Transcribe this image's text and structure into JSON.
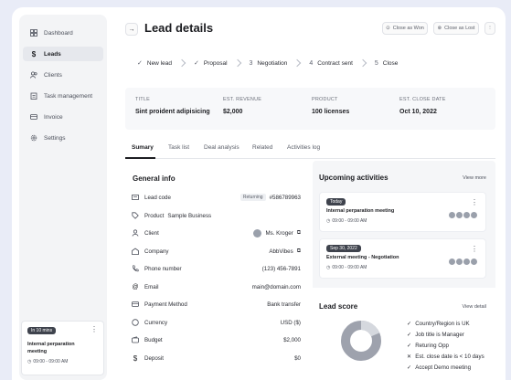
{
  "sidebar": {
    "items": [
      {
        "label": "Dashboard",
        "icon": "grid-icon"
      },
      {
        "label": "Leads",
        "icon": "dollar-icon"
      },
      {
        "label": "Clients",
        "icon": "users-icon"
      },
      {
        "label": "Task management",
        "icon": "clipboard-icon"
      },
      {
        "label": "Invoice",
        "icon": "invoice-icon"
      },
      {
        "label": "Settings",
        "icon": "gear-icon"
      }
    ],
    "reminder": {
      "badge": "In 10 mins",
      "title": "Internal perparation meeting",
      "time": "09:00 - 09:00 AM"
    }
  },
  "header": {
    "title": "Lead details",
    "close_won": "Close as Won",
    "close_lost": "Close as Lost"
  },
  "stepper": [
    {
      "mark": "✓",
      "label": "New lead"
    },
    {
      "mark": "✓",
      "label": "Proposal"
    },
    {
      "mark": "3",
      "label": "Negotiation"
    },
    {
      "mark": "4",
      "label": "Contract sent"
    },
    {
      "mark": "5",
      "label": "Close"
    }
  ],
  "summary": {
    "title_label": "TITLE",
    "title_value": "Sint proident adipisicing",
    "revenue_label": "EST. REVENUE",
    "revenue_value": "$2,000",
    "product_label": "PRODUCT",
    "product_value": "100 licenses",
    "close_label": "EST. CLOSE DATE",
    "close_value": "Oct 10, 2022"
  },
  "tabs": [
    "Sumary",
    "Task list",
    "Deal analysis",
    "Related",
    "Activities log"
  ],
  "general_info": {
    "title": "General info",
    "rows": [
      {
        "label": "Lead code",
        "value": "#586789963",
        "badge": "Returning"
      },
      {
        "label": "Product",
        "value": "Sample Business"
      },
      {
        "label": "Client",
        "value": "Ms. Kroger"
      },
      {
        "label": "Company",
        "value": "AbbVibes"
      },
      {
        "label": "Phone number",
        "value": "(123) 456-7891"
      },
      {
        "label": "Email",
        "value": "main@domain.com"
      },
      {
        "label": "Payment Method",
        "value": "Bank transfer"
      },
      {
        "label": "Currency",
        "value": "USD ($)"
      },
      {
        "label": "Budget",
        "value": "$2,000"
      },
      {
        "label": "Deposit",
        "value": "$0"
      }
    ]
  },
  "upcoming": {
    "title": "Upcoming activities",
    "view_more": "View more",
    "items": [
      {
        "badge": "Today",
        "title": "Internal perparation meeting",
        "time": "09:00 - 09:00 AM"
      },
      {
        "badge": "Sep 30, 2022",
        "title": "External meeting - Negotiation",
        "time": "09:00 - 09:00 AM"
      }
    ]
  },
  "lead_score": {
    "title": "Lead score",
    "view_detail": "View detail",
    "items": [
      {
        "mark": "✓",
        "label": "Country/Region is UK"
      },
      {
        "mark": "✓",
        "label": "Job title is Manager"
      },
      {
        "mark": "✓",
        "label": "Returing Opp"
      },
      {
        "mark": "✕",
        "label": "Est. close date is < 10 days"
      },
      {
        "mark": "✓",
        "label": "Accept Demo meeting"
      }
    ]
  },
  "colors": {
    "dark": "#3f434d",
    "accent": "#1c1d21",
    "panel": "#f5f6f8"
  }
}
